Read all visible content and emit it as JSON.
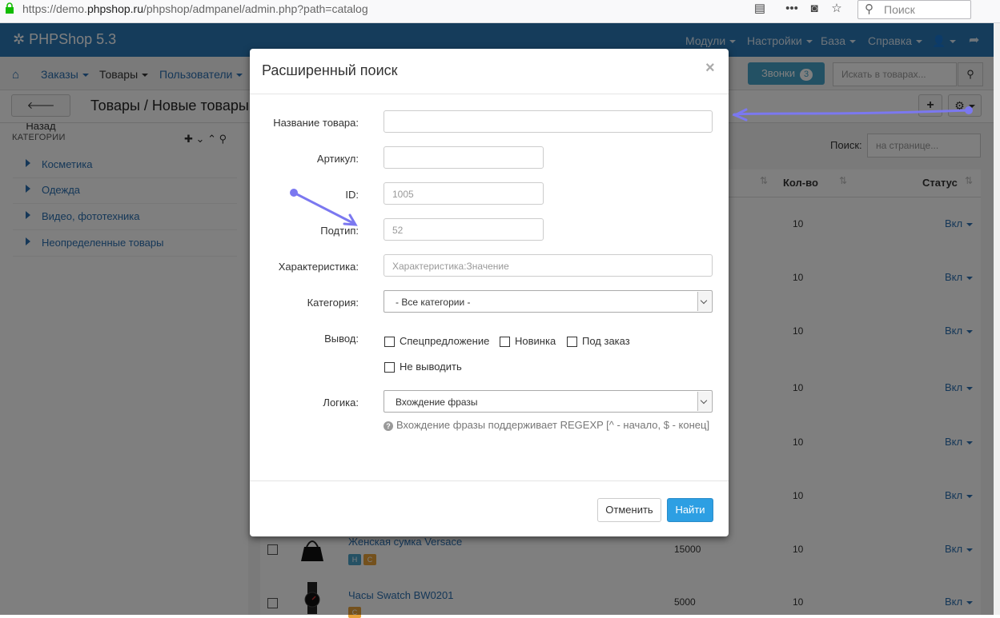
{
  "browser": {
    "url_prefix": "https://demo.",
    "url_domain": "phpshop.ru",
    "url_path": "/phpshop/admpanel/admin.php?path=catalog",
    "search_placeholder": "Поиск"
  },
  "navbar": {
    "brand": "PHPShop 5.3",
    "menus": [
      "Модули",
      "Настройки",
      "База",
      "Справка"
    ]
  },
  "subnav": {
    "items": [
      "Заказы",
      "Товары",
      "Пользователи"
    ],
    "calls_label": "Звонки",
    "calls_count": "3",
    "search_placeholder": "Искать в товарах..."
  },
  "page": {
    "back_label": "Назад",
    "title": "Товары / Новые товары"
  },
  "sidebar": {
    "header": "КАТЕГОРИИ",
    "categories": [
      "Косметика",
      "Одежда",
      "Видео, фототехника",
      "Неопределенные товары"
    ]
  },
  "table": {
    "search_label": "Поиск:",
    "search_placeholder": "на странице...",
    "columns": [
      "Кол-во",
      "Статус"
    ],
    "rows": [
      {
        "qty": "10",
        "status": "Вкл"
      },
      {
        "qty": "10",
        "status": "Вкл"
      },
      {
        "qty": "10",
        "status": "Вкл"
      },
      {
        "qty": "10",
        "status": "Вкл"
      },
      {
        "qty": "10",
        "status": "Вкл"
      },
      {
        "qty": "10",
        "status": "Вкл"
      },
      {
        "name": "Женская сумка Versace",
        "price": "15000",
        "qty": "10",
        "status": "Вкл",
        "tags": [
          "Н",
          "С"
        ]
      },
      {
        "name": "Часы Swatch BW0201",
        "price": "5000",
        "qty": "10",
        "status": "Вкл",
        "tags": [
          "С"
        ]
      }
    ]
  },
  "modal": {
    "title": "Расширенный поиск",
    "close": "×",
    "fields": {
      "name_label": "Название товара:",
      "article_label": "Артикул:",
      "id_label": "ID:",
      "id_placeholder": "1005",
      "subtype_label": "Подтип:",
      "subtype_placeholder": "52",
      "char_label": "Характеристика:",
      "char_placeholder": "Характеристика:Значение",
      "category_label": "Категория:",
      "category_value": "- Все категории -",
      "output_label": "Вывод:",
      "output_options": [
        "Спецпредложение",
        "Новинка",
        "Под заказ",
        "Не выводить"
      ],
      "logic_label": "Логика:",
      "logic_value": "Вхождение фразы",
      "hint": "Вхождение фразы поддерживает REGEXP [^ - начало, $ - конец]"
    },
    "cancel_label": "Отменить",
    "find_label": "Найти"
  },
  "colors": {
    "navbar": "#2b79b7",
    "link": "#2a6fb0",
    "primary_button": "#2d9fe3",
    "annotation": "#7b78f0",
    "tag_n": "#4aa3c9",
    "tag_c": "#e8a23a"
  }
}
